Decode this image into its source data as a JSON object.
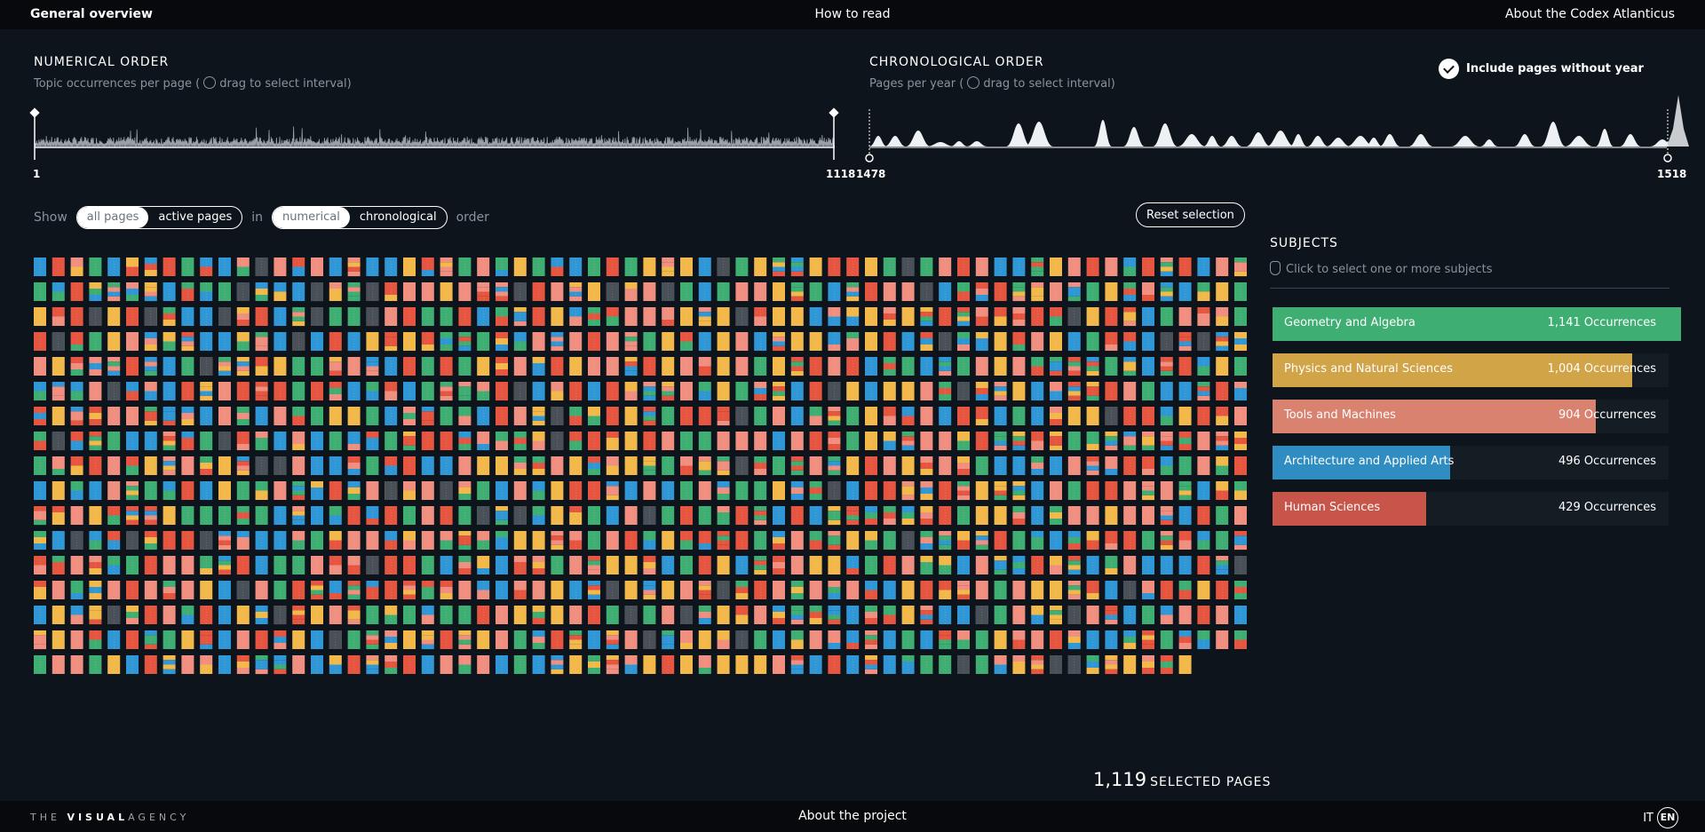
{
  "nav": {
    "left": "General overview",
    "center": "How to read",
    "right": "About the Codex Atlanticus"
  },
  "numerical": {
    "title": "NUMERICAL ORDER",
    "subtitle_a": "Topic occurrences per page (",
    "subtitle_b": "drag to select interval)",
    "min_label": "1",
    "max_label": "1118"
  },
  "chronological": {
    "title": "CHRONOLOGICAL ORDER",
    "subtitle_a": "Pages per year (",
    "subtitle_b": "drag to select interval)",
    "min_label": "1478",
    "max_label": "1518",
    "include_label": "Include pages without year"
  },
  "controls": {
    "show": "Show",
    "all_pages": "all pages",
    "active_pages": "active pages",
    "in": "in",
    "numerical": "numerical",
    "chronological": "chronological",
    "order": "order",
    "reset": "Reset selection"
  },
  "subjects": {
    "title": "SUBJECTS",
    "hint": "Click to select one or more subjects",
    "items": [
      {
        "name": "Geometry and Algebra",
        "occurrences": "1,141 Occurrences",
        "value": 1141,
        "color": "#3fae73"
      },
      {
        "name": "Physics and Natural Sciences",
        "occurrences": "1,004 Occurrences",
        "value": 1004,
        "color": "#d1a448"
      },
      {
        "name": "Tools and Machines",
        "occurrences": "904 Occurrences",
        "value": 904,
        "color": "#d9826f"
      },
      {
        "name": "Architecture and Applied Arts",
        "occurrences": "496 Occurrences",
        "value": 496,
        "color": "#2f8dc2"
      },
      {
        "name": "Human Sciences",
        "occurrences": "429 Occurrences",
        "value": 429,
        "color": "#c8554a"
      }
    ]
  },
  "page_colors": [
    "#f08f7f",
    "#3fae73",
    "#f3b84a",
    "#2f97d6",
    "#e5553f",
    "#4a5058"
  ],
  "selected": {
    "count": "1,119",
    "label": "SELECTED PAGES"
  },
  "footer": {
    "logo_a": "THE ",
    "logo_b": "VISUAL",
    "logo_c": "AGENCY",
    "about": "About the project",
    "lang_it": "IT",
    "lang_en": "EN"
  }
}
